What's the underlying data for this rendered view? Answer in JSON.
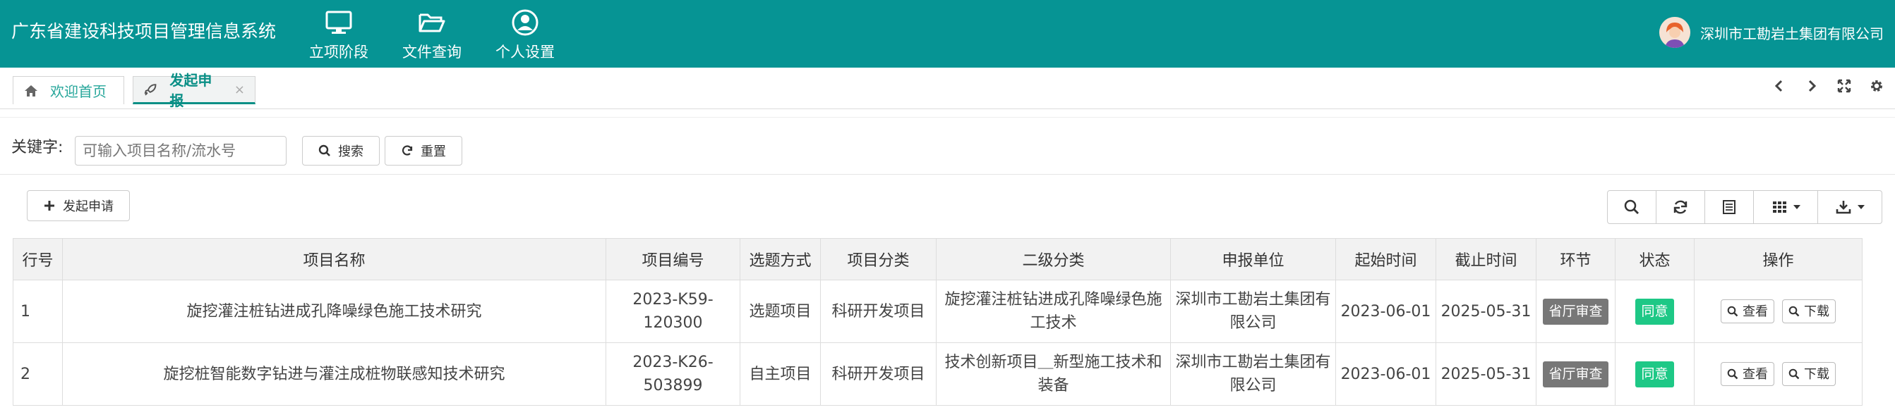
{
  "header": {
    "title": "广东省建设科技项目管理信息系统",
    "nav": [
      {
        "label": "立项阶段",
        "icon": "monitor-icon"
      },
      {
        "label": "文件查询",
        "icon": "folder-open-icon"
      },
      {
        "label": "个人设置",
        "icon": "user-circle-icon"
      }
    ],
    "user": "深圳市工勘岩土集团有限公司"
  },
  "tabs": [
    {
      "label": "欢迎首页",
      "icon": "home-icon"
    },
    {
      "label": "发起申报",
      "icon": "rocket-icon",
      "close": "×"
    }
  ],
  "search": {
    "label": "关键字:",
    "placeholder": "可输入项目名称/流水号",
    "search_btn": "搜索",
    "reset_btn": "重置"
  },
  "toolbar": {
    "add_btn": "发起申请"
  },
  "table": {
    "headers": [
      "行号",
      "项目名称",
      "项目编号",
      "选题方式",
      "项目分类",
      "二级分类",
      "申报单位",
      "起始时间",
      "截止时间",
      "环节",
      "状态",
      "操作"
    ],
    "rows": [
      {
        "no": "1",
        "name": "旋挖灌注桩钻进成孔降噪绿色施工技术研究",
        "code": "2023-K59-120300",
        "method": "选题项目",
        "category": "科研开发项目",
        "subcategory": "旋挖灌注桩钻进成孔降噪绿色施工技术",
        "unit": "深圳市工勘岩土集团有限公司",
        "start": "2023-06-01",
        "end": "2025-05-31",
        "stage": "省厅审查",
        "status": "同意",
        "view": "查看",
        "download": "下载"
      },
      {
        "no": "2",
        "name": "旋挖桩智能数字钻进与灌注成桩物联感知技术研究",
        "code": "2023-K26-503899",
        "method": "自主项目",
        "category": "科研开发项目",
        "subcategory": "技术创新项目＿新型施工技术和装备",
        "unit": "深圳市工勘岩土集团有限公司",
        "start": "2023-06-01",
        "end": "2025-05-31",
        "stage": "省厅审查",
        "status": "同意",
        "view": "查看",
        "download": "下载"
      }
    ]
  },
  "colors": {
    "header_bg": "#069494",
    "accent": "#0a8f86",
    "status_green": "#1ec886",
    "stage_grey": "#777777"
  }
}
